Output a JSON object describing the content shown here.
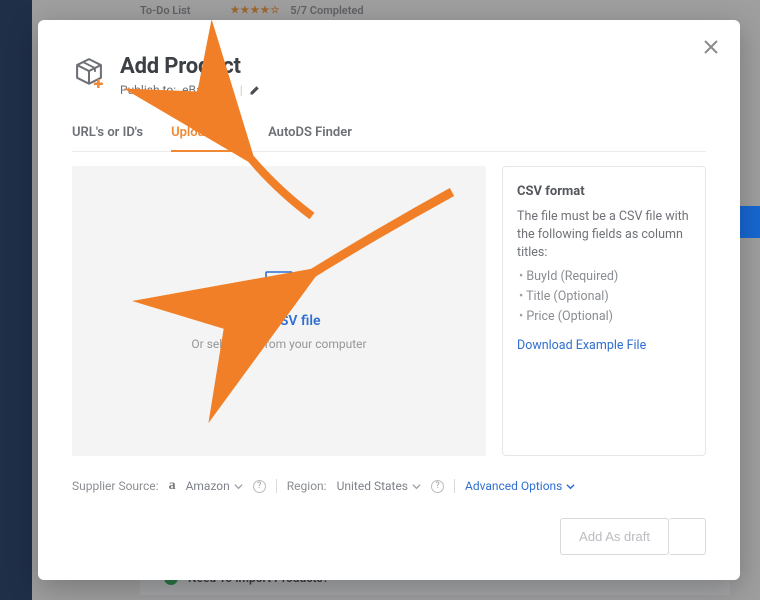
{
  "background": {
    "todo_label": "To-Do List",
    "stars": "★★★★☆",
    "progress": "5/7 Completed",
    "need_import": "Need To Import Products?"
  },
  "modal": {
    "title": "Add Product",
    "publish_label": "Publish to:",
    "publish_target": "eBay USA"
  },
  "tabs": {
    "urls": "URL's or ID's",
    "csv": "Upload CSV",
    "finder": "AutoDS Finder"
  },
  "drop": {
    "title": "Drop CSV file",
    "subtitle": "Or select file from your computer"
  },
  "side": {
    "heading": "CSV format",
    "desc": "The file must be a CSV file with the following fields as column titles:",
    "fields": {
      "f1": "BuyId (Required)",
      "f2": "Title (Optional)",
      "f3": "Price (Optional)"
    },
    "download": "Download Example File"
  },
  "footer": {
    "supplier_label": "Supplier Source:",
    "supplier_value": "Amazon",
    "region_label": "Region:",
    "region_value": "United States",
    "advanced": "Advanced Options"
  },
  "actions": {
    "add_draft": "Add As draft"
  },
  "icons": {
    "amazon_glyph": "a"
  }
}
